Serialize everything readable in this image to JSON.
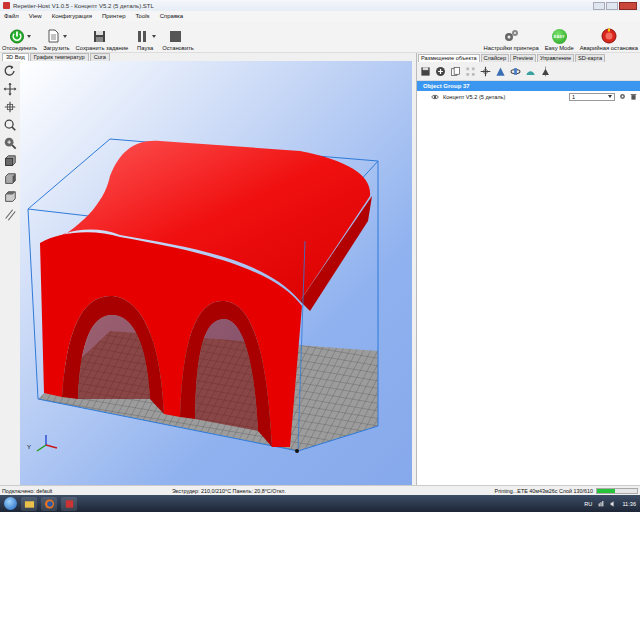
{
  "window": {
    "title": "Repetier-Host V1.0.5 - Концепт V5.2 (5 деталь).STL"
  },
  "menu": [
    "Файл",
    "View",
    "Конфигурация",
    "Принтер",
    "Tools",
    "Справка"
  ],
  "toolbar": {
    "left": [
      {
        "label": "Отсоединить",
        "dropdown": true
      },
      {
        "label": "Загрузить",
        "dropdown": true
      },
      {
        "label": "Сохранить задание",
        "dropdown": false
      },
      {
        "label": "Пауза",
        "dropdown": true
      },
      {
        "label": "Остановить",
        "dropdown": false
      }
    ],
    "right": [
      {
        "label": "Настройки принтера"
      },
      {
        "label": "Easy Mode",
        "badge": "EASY"
      },
      {
        "label": "Аварийная остановка"
      }
    ]
  },
  "view_tabs": [
    {
      "label": "3D Вид",
      "selected": true
    },
    {
      "label": "График температур",
      "selected": false
    },
    {
      "label": "Cura",
      "selected": false
    }
  ],
  "view": {
    "axis_label": "Y"
  },
  "right_tabs": [
    {
      "label": "Размещение объекта",
      "selected": true
    },
    {
      "label": "Слайсер",
      "selected": false
    },
    {
      "label": "Preview",
      "selected": false
    },
    {
      "label": "Управление",
      "selected": false
    },
    {
      "label": "SD-карта",
      "selected": false
    }
  ],
  "object_group": {
    "label": "Object Group 37",
    "selected": true
  },
  "objects": [
    {
      "name": "Концепт V5.2 (5 деталь)",
      "visible": true,
      "copies": "1"
    }
  ],
  "status_bar": {
    "connection": "Подключено: default",
    "temperatures": "Экструдер: 210,0/210°C Панель: 20,8°C/Откл.",
    "job": "Printing...ETE 40м43м26с Слой 130/610",
    "level": 0.45
  },
  "taskbar": {
    "language": "RU",
    "time": "11:36"
  }
}
